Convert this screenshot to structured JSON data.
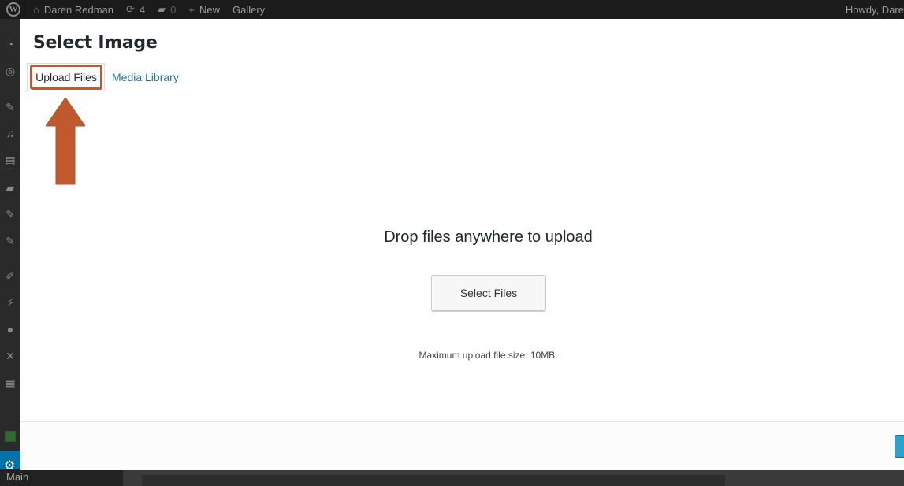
{
  "adminbar": {
    "site_name": "Daren Redman",
    "updates_count": "4",
    "comments_count": "0",
    "new_label": "New",
    "gallery_label": "Gallery",
    "howdy": "Howdy, Dare"
  },
  "sidebar": {
    "main_label": "Main"
  },
  "modal": {
    "title": "Select Image",
    "tabs": [
      {
        "label": "Upload Files",
        "active": true
      },
      {
        "label": "Media Library",
        "active": false
      }
    ],
    "drop_text": "Drop files anywhere to upload",
    "select_button": "Select Files",
    "max_size": "Maximum upload file size: 10MB."
  },
  "colors": {
    "highlight": "#c05a2e",
    "link": "#21759b",
    "admin_bar": "#1b1b1b",
    "primary_button": "#2ea2cc"
  },
  "icons": [
    "wordpress-logo-icon",
    "home-icon",
    "updates-icon",
    "comment-icon",
    "plus-icon",
    "gear-icon",
    "up-arrow-annotation"
  ]
}
